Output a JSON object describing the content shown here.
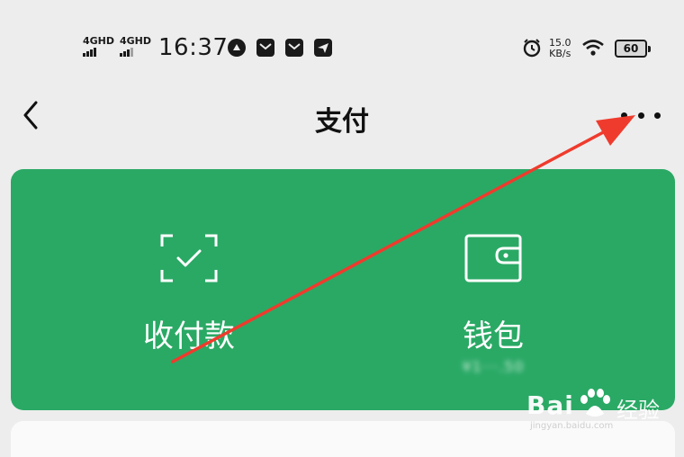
{
  "status_bar": {
    "network_1": "4GHD",
    "network_2": "4GHD",
    "time": "16:37",
    "speed_value": "15.0",
    "speed_unit": "KB/s",
    "battery": "60",
    "icons": [
      "app-icon",
      "mail-icon",
      "mail-icon",
      "telegram-icon",
      "alarm-icon",
      "wifi-icon",
      "battery-icon"
    ]
  },
  "nav": {
    "title": "支付",
    "back_icon": "chevron-left-icon",
    "more_icon": "more-dots-icon"
  },
  "pay_card": {
    "background": "#2aa965",
    "receive_pay": {
      "label": "收付款",
      "icon": "scan-check-icon"
    },
    "wallet": {
      "label": "钱包",
      "icon": "wallet-icon",
      "balance": "¥1",
      "balance_masked": "¥1···.50"
    }
  },
  "annotation": {
    "color": "#ef3b2d"
  },
  "watermark": {
    "brand": "Bai",
    "brand_cn": "经验",
    "sub": "jingyan.baidu.com"
  }
}
